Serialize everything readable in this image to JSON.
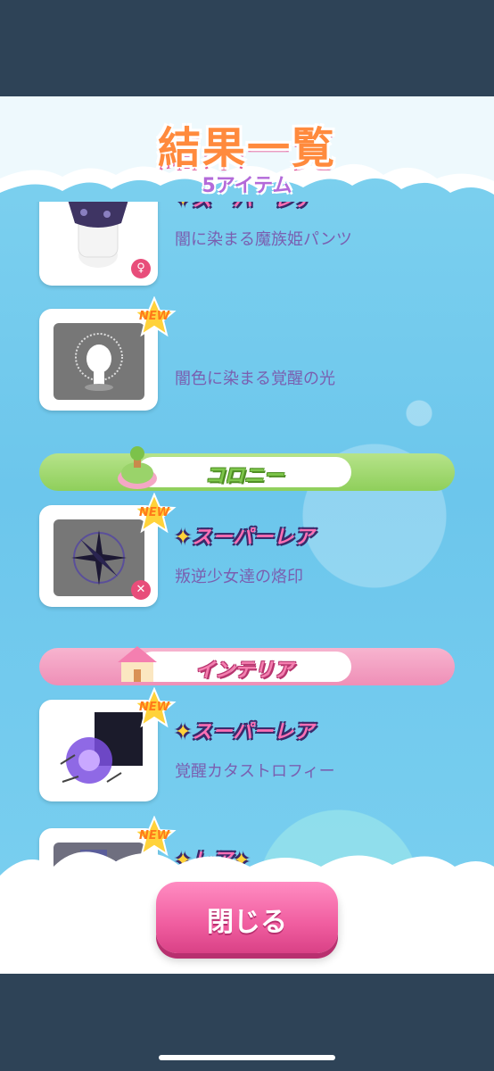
{
  "header": {
    "title": "結果一覧",
    "count": "5アイテム"
  },
  "badges": {
    "new": "NEW"
  },
  "rarity": {
    "super_rare": "スーパーレア",
    "rare": "レア"
  },
  "categories": {
    "colony": "コロニー",
    "interior": "インテリア"
  },
  "items": [
    {
      "name": "闇に染まる魔族姫パンツ",
      "rarity": "スーパーレア"
    },
    {
      "name": "闇色に染まる覚醒の光",
      "rarity": ""
    },
    {
      "name": "叛逆少女達の烙印",
      "rarity": "スーパーレア"
    },
    {
      "name": "覚醒カタストロフィー",
      "rarity": "スーパーレア"
    },
    {
      "name": "",
      "rarity": "レア"
    }
  ],
  "footer": {
    "close_label": "閉じる"
  },
  "colors": {
    "title": "#ff8a3d",
    "subtitle": "#b36ad9",
    "green_bar": "#8fcf5b",
    "pink_bar": "#ef8fb7",
    "close_button": "#f05d9f"
  },
  "icons": [
    "new-star-icon",
    "gender-icon",
    "colony-icon",
    "interior-icon",
    "sparkle-icon"
  ]
}
